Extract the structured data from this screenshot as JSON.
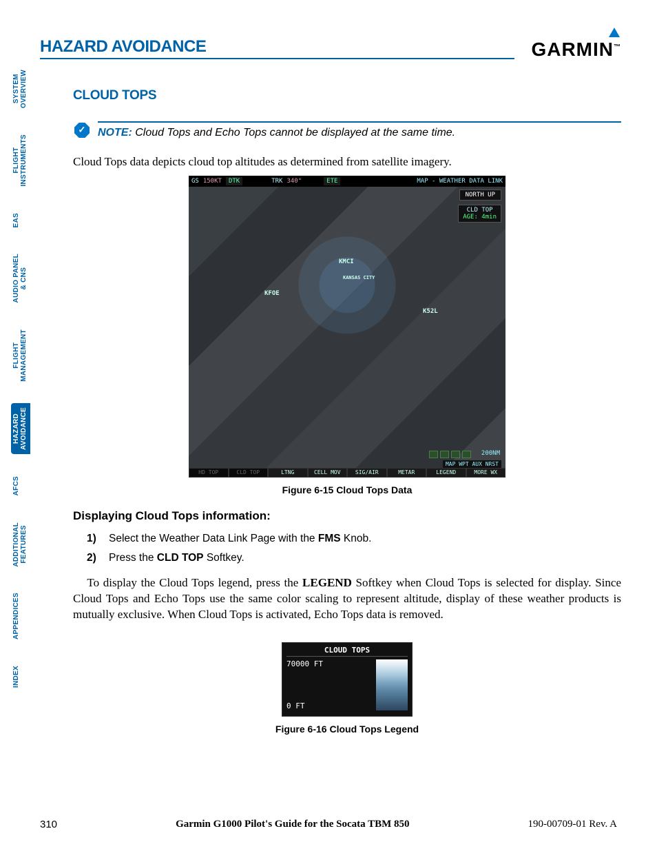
{
  "header": {
    "title": "HAZARD AVOIDANCE",
    "logo": "GARMIN"
  },
  "tabs": [
    {
      "label": "SYSTEM\nOVERVIEW",
      "active": false
    },
    {
      "label": "FLIGHT\nINSTRUMENTS",
      "active": false
    },
    {
      "label": "EAS",
      "active": false
    },
    {
      "label": "AUDIO PANEL\n& CNS",
      "active": false
    },
    {
      "label": "FLIGHT\nMANAGEMENT",
      "active": false
    },
    {
      "label": "HAZARD\nAVOIDANCE",
      "active": true
    },
    {
      "label": "AFCS",
      "active": false
    },
    {
      "label": "ADDITIONAL\nFEATURES",
      "active": false
    },
    {
      "label": "APPENDICES",
      "active": false
    },
    {
      "label": "INDEX",
      "active": false
    }
  ],
  "section": {
    "heading": "CLOUD TOPS"
  },
  "note": {
    "label": "NOTE:",
    "body": "Cloud Tops and Echo Tops cannot be displayed at the same time."
  },
  "intro_p": "Cloud Tops data depicts cloud top altitudes as determined from satellite imagery.",
  "fig1": {
    "caption": "Figure 6-15  Cloud Tops Data",
    "top_gs_label": "GS",
    "top_gs": "150KT",
    "top_dtk_label": "DTK",
    "top_trk_label": "TRK",
    "top_trk": "340°",
    "top_ete_label": "ETE",
    "top_right": "MAP - WEATHER DATA LINK",
    "north_up": "NORTH UP",
    "cld_top_badge": "CLD TOP",
    "cld_top_age": "AGE: 4min",
    "wp1": "KMCI",
    "wp1b": "KANSAS CITY",
    "wp2": "KFOE",
    "wp3": "K52L",
    "scale": "200NM",
    "softkeys": [
      "HD TOP",
      "CLD TOP",
      "LTNG",
      "CELL MOV",
      "SIG/AIR",
      "METAR",
      "LEGEND",
      "MORE WX"
    ],
    "softbar": "MAP WPT AUX NRST"
  },
  "proc": {
    "heading": "Displaying Cloud Tops information:",
    "step1_pre": "Select the Weather Data Link Page with the ",
    "step1_b": "FMS",
    "step1_post": " Knob.",
    "step2_pre": "Press the ",
    "step2_b": "CLD TOP",
    "step2_post": " Softkey."
  },
  "body2_pre": "To display the Cloud Tops legend, press the ",
  "body2_b": "LEGEND",
  "body2_post": " Softkey when Cloud Tops is selected for display. Since Cloud Tops and Echo Tops use the same color scaling to represent altitude, display of these weather products is mutually exclusive.  When Cloud Tops is activated, Echo Tops data is removed.",
  "fig2": {
    "caption": "Figure 6-16  Cloud Tops Legend",
    "title": "CLOUD TOPS",
    "max": "70000 FT",
    "min": "0 FT"
  },
  "footer": {
    "page": "310",
    "center": "Garmin G1000 Pilot's Guide for the Socata TBM 850",
    "right": "190-00709-01  Rev. A"
  }
}
